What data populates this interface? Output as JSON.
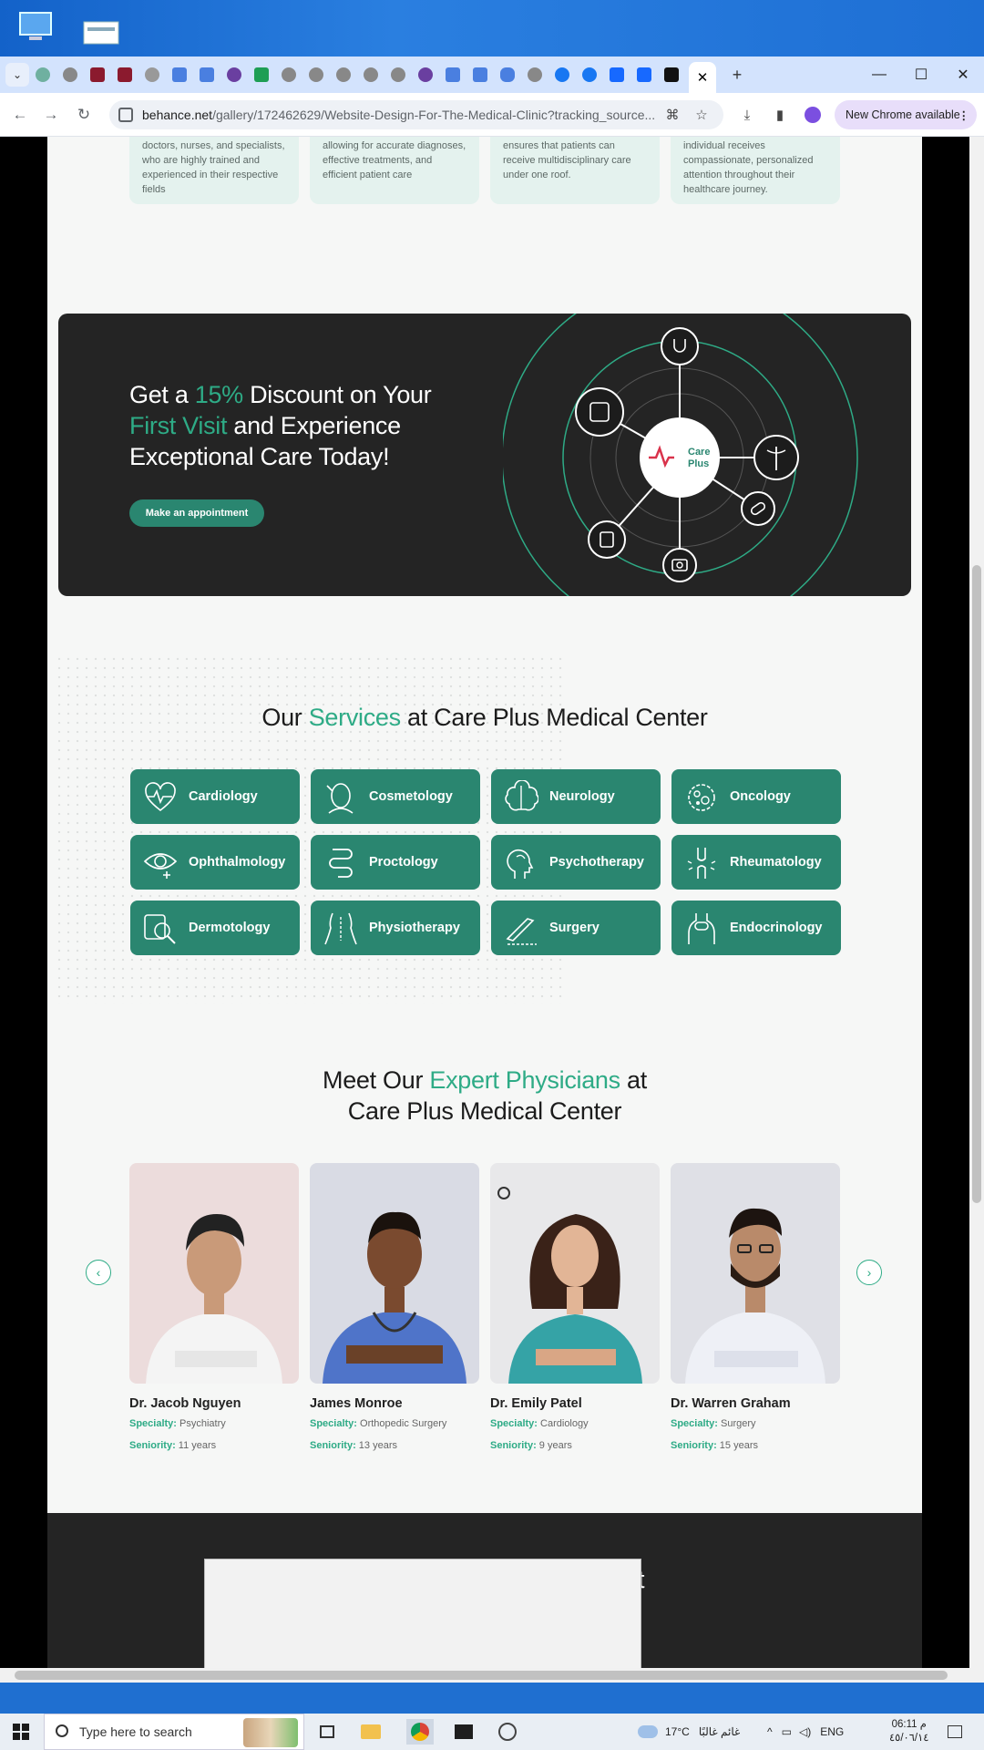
{
  "browser": {
    "url_host": "behance.net",
    "url_path": "/gallery/172462629/Website-Design-For-The-Medical-Clinic?tracking_source...",
    "update_label": "New Chrome available",
    "new_tab_symbol": "+",
    "close_tab_symbol": "✕"
  },
  "features": [
    {
      "text": "doctors, nurses, and specialists, who are highly trained and experienced in their respective fields"
    },
    {
      "text": "allowing for accurate diagnoses, effective treatments, and efficient patient care"
    },
    {
      "text": "ensures that patients can receive multidisciplinary care under one roof."
    },
    {
      "text": "individual receives compassionate, personalized attention throughout their healthcare journey."
    }
  ],
  "promo": {
    "line1_pre": "Get a ",
    "line1_hl": "15%",
    "line1_post": " Discount on Your",
    "line2_hl": "First Visit",
    "line2_post": " and Experience",
    "line3": "Exceptional Care Today!",
    "button": "Make an appointment",
    "logo_line1": "Care",
    "logo_line2": "Plus"
  },
  "services": {
    "title_pre": "Our ",
    "title_hl": "Services",
    "title_post": " at Care Plus Medical Center",
    "items": [
      {
        "label": "Cardiology",
        "icon": "heart-pulse-icon"
      },
      {
        "label": "Cosmetology",
        "icon": "face-icon"
      },
      {
        "label": "Neurology",
        "icon": "brain-icon"
      },
      {
        "label": "Oncology",
        "icon": "cell-icon"
      },
      {
        "label": "Ophthalmology",
        "icon": "eye-icon"
      },
      {
        "label": "Proctology",
        "icon": "intestine-icon"
      },
      {
        "label": "Psychotherapy",
        "icon": "head-icon"
      },
      {
        "label": "Rheumatology",
        "icon": "joint-icon"
      },
      {
        "label": "Dermotology",
        "icon": "skin-magnifier-icon"
      },
      {
        "label": "Physiotherapy",
        "icon": "body-icon"
      },
      {
        "label": "Surgery",
        "icon": "scalpel-icon"
      },
      {
        "label": "Endocrinology",
        "icon": "thyroid-icon"
      }
    ]
  },
  "physicians": {
    "title_pre": "Meet Our ",
    "title_hl": "Expert Physicians",
    "title_post": " at",
    "title_line2": "Care Plus Medical Center",
    "specialty_label": "Specialty:",
    "seniority_label": "Seniority:",
    "doctors": [
      {
        "name": "Dr. Jacob Nguyen",
        "specialty": "Psychiatry",
        "seniority": "11 years",
        "bg": "#ecdcdc",
        "coat": "#f4f4f4",
        "skin": "#c99a79"
      },
      {
        "name": "James Monroe",
        "specialty": "Orthopedic Surgery",
        "seniority": "13 years",
        "bg": "#d9dbe4",
        "coat": "#4f74c9",
        "skin": "#7a4a2f"
      },
      {
        "name": "Dr. Emily Patel",
        "specialty": "Cardiology",
        "seniority": "9 years",
        "bg": "#e8e8ea",
        "coat": "#35a3a6",
        "skin": "#e2b596"
      },
      {
        "name": "Dr. Warren Graham",
        "specialty": "Surgery",
        "seniority": "15 years",
        "bg": "#dfe0e6",
        "coat": "#eef0f6",
        "skin": "#b98a6a"
      }
    ]
  },
  "footer_partial": "t",
  "taskbar": {
    "search_placeholder": "Type here to search",
    "weather": "17°C",
    "weather_desc": "غائم غالبًا",
    "lang": "ENG",
    "time": "06:11 م",
    "date": "٤٥/٠٦/١٤"
  },
  "colors": {
    "accent": "#2eab86",
    "button": "#2a8670",
    "dark": "#242424"
  }
}
